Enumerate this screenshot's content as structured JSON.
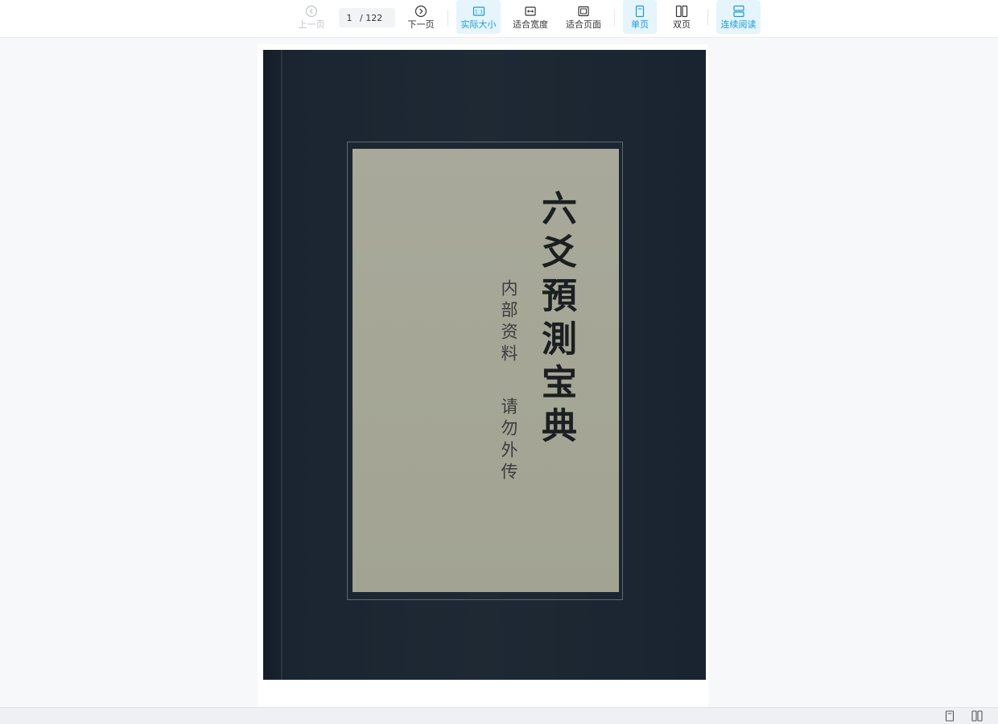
{
  "toolbar": {
    "prev_label": "上一页",
    "next_label": "下一页",
    "page_current": "1",
    "page_total": "/ 122",
    "actual_size_label": "实际大小",
    "fit_width_label": "适合宽度",
    "fit_page_label": "适合页面",
    "single_page_label": "单页",
    "double_page_label": "双页",
    "continuous_label": "连续阅读",
    "actual_size_glyph": "1:1"
  },
  "document": {
    "title": "六爻預測宝典",
    "note_line1": "内部资料",
    "note_line2": "请勿外传"
  },
  "colors": {
    "accent": "#1a9bd7",
    "active_bg": "#e6f4fb",
    "cover_dark": "#1e2934",
    "label_paper": "#a5a696"
  }
}
